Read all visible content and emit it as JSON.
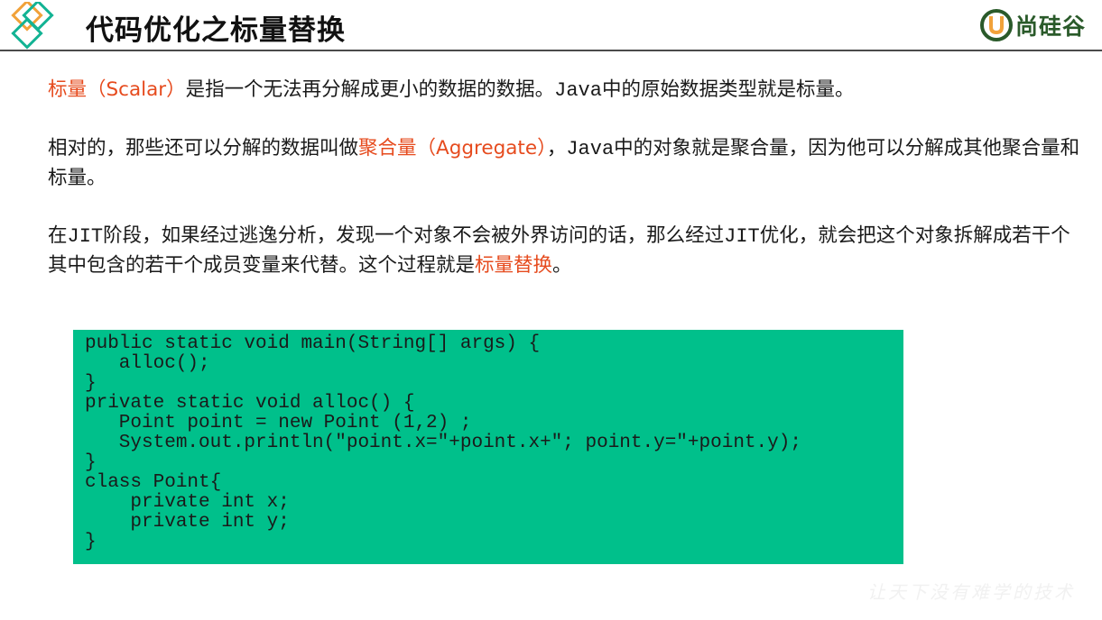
{
  "header": {
    "title": "代码优化之标量替换",
    "brand_name": "尚硅谷",
    "colors": {
      "diamond_orange": "#f1a23a",
      "diamond_teal": "#13b394",
      "brand_green": "#2a5a2a",
      "brand_orange": "#f1a23a"
    }
  },
  "paragraphs": {
    "p1": {
      "term": "标量（Scalar）",
      "text_a": "是指一个无法再分解成更小的数据的数据。",
      "java": "Java",
      "text_b": "中的原始数据类型就是标量。"
    },
    "p2": {
      "text_a": "相对的，那些还可以分解的数据叫做",
      "term": "聚合量（Aggregate）",
      "text_b": "，",
      "java": "Java",
      "text_c": "中的对象就是聚合量，因为他可以分解成其他聚合量和标量。"
    },
    "p3": {
      "text_a": "在",
      "jit1": "JIT",
      "text_b": "阶段，如果经过逃逸分析，发现一个对象不会被外界访问的话，那么经过",
      "jit2": "JIT",
      "text_c": "优化，就会把这个对象拆解成若干个其中包含的若干个成员变量来代替。这个过程就是",
      "term": "标量替换",
      "text_d": "。"
    }
  },
  "code": {
    "source": "public static void main(String[] args) {\n   alloc();\n}\nprivate static void alloc() {\n   Point point = new Point (1,2) ;\n   System.out.println(\"point.x=\"+point.x+\"; point.y=\"+point.y);\n}\nclass Point{\n    private int x;\n    private int y;\n}",
    "background_color": "#00c08b"
  },
  "watermark": {
    "text": "让天下没有难学的技术"
  },
  "colors": {
    "highlight": "#e64b1e",
    "text": "#1a1a1a",
    "rule": "#4b4b4b"
  }
}
